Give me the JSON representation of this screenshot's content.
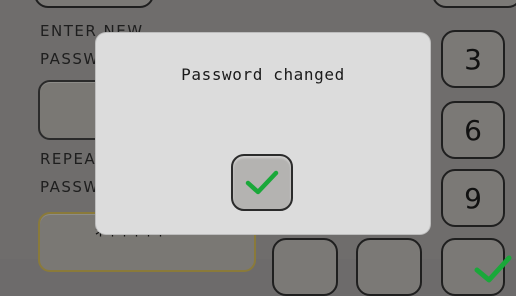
{
  "form": {
    "new_password_label_line1": "ENTER NEW",
    "new_password_label_line2": "PASSWORD",
    "repeat_label_line1": "REPEAT",
    "repeat_label_line2": "PASSWORD",
    "repeat_value": "******"
  },
  "keypad": {
    "keys": [
      "3",
      "6",
      "9"
    ]
  },
  "dialog": {
    "message": "Password changed",
    "confirm_icon": "checkmark-icon"
  },
  "colors": {
    "accent_check": "#1aa83a",
    "dialog_bg": "#dcdcdc",
    "screen_bg": "#6f6d6c"
  }
}
